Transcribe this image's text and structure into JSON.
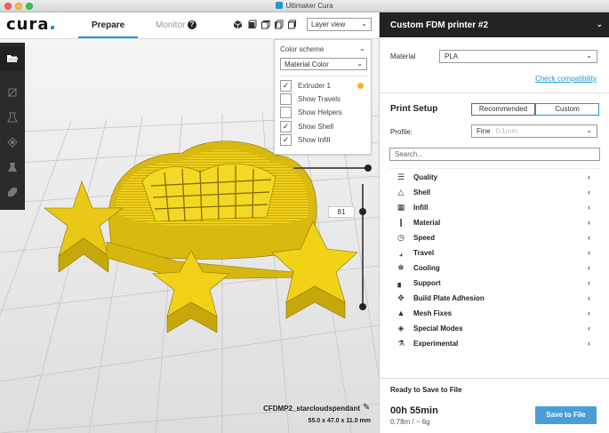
{
  "window": {
    "title": "Ultimaker Cura"
  },
  "header": {
    "logo": "cura",
    "tabs": [
      {
        "label": "Prepare",
        "active": true
      },
      {
        "label": "Monitor",
        "active": false
      }
    ],
    "help_icon": "?",
    "view_mode": "Layer view",
    "view_buttons": [
      "3d-view-icon",
      "front-view-icon",
      "top-view-icon",
      "left-view-icon",
      "right-view-icon"
    ]
  },
  "toolbar": {
    "items": [
      "open-folder-icon",
      "move-icon",
      "scale-icon",
      "rotate-icon",
      "mirror-icon",
      "per-model-settings-icon"
    ]
  },
  "color_panel": {
    "scheme_label": "Color scheme",
    "scheme_value": "Material Color",
    "options": [
      {
        "label": "Extruder 1",
        "checked": true,
        "color": "#f0b52e"
      },
      {
        "label": "Show Travels",
        "checked": false
      },
      {
        "label": "Show Helpers",
        "checked": false
      },
      {
        "label": "Show Shell",
        "checked": true
      },
      {
        "label": "Show Infill",
        "checked": true
      }
    ]
  },
  "layer_slider": {
    "value": "81"
  },
  "model": {
    "filename": "CFDMP2_starcloudspendant",
    "dimensions": "55.0 x 47.0 x 11.0 mm",
    "color": "#f2d218"
  },
  "right_panel": {
    "printer_name": "Custom FDM printer #2",
    "material_label": "Material",
    "material_value": "PLA",
    "check_compat": "Check compatibility",
    "print_setup_title": "Print Setup",
    "mode_recommended": "Recommended",
    "mode_custom": "Custom",
    "profile_label": "Profile:",
    "profile_value": "Fine",
    "profile_hint": "0.1mm",
    "search_placeholder": "Search...",
    "categories": [
      {
        "label": "Quality",
        "icon": "quality-icon"
      },
      {
        "label": "Shell",
        "icon": "shell-icon"
      },
      {
        "label": "Infill",
        "icon": "infill-icon"
      },
      {
        "label": "Material",
        "icon": "material-icon"
      },
      {
        "label": "Speed",
        "icon": "speed-icon"
      },
      {
        "label": "Travel",
        "icon": "travel-icon"
      },
      {
        "label": "Cooling",
        "icon": "cooling-icon"
      },
      {
        "label": "Support",
        "icon": "support-icon"
      },
      {
        "label": "Build Plate Adhesion",
        "icon": "build-plate-adhesion-icon"
      },
      {
        "label": "Mesh Fixes",
        "icon": "mesh-fixes-icon"
      },
      {
        "label": "Special Modes",
        "icon": "special-modes-icon"
      },
      {
        "label": "Experimental",
        "icon": "experimental-icon"
      }
    ],
    "ready_text": "Ready to Save to File",
    "print_time": "00h 55min",
    "material_usage": "0.78m / ~ 6g",
    "save_button": "Save to File",
    "accent": "#1a99d6"
  }
}
